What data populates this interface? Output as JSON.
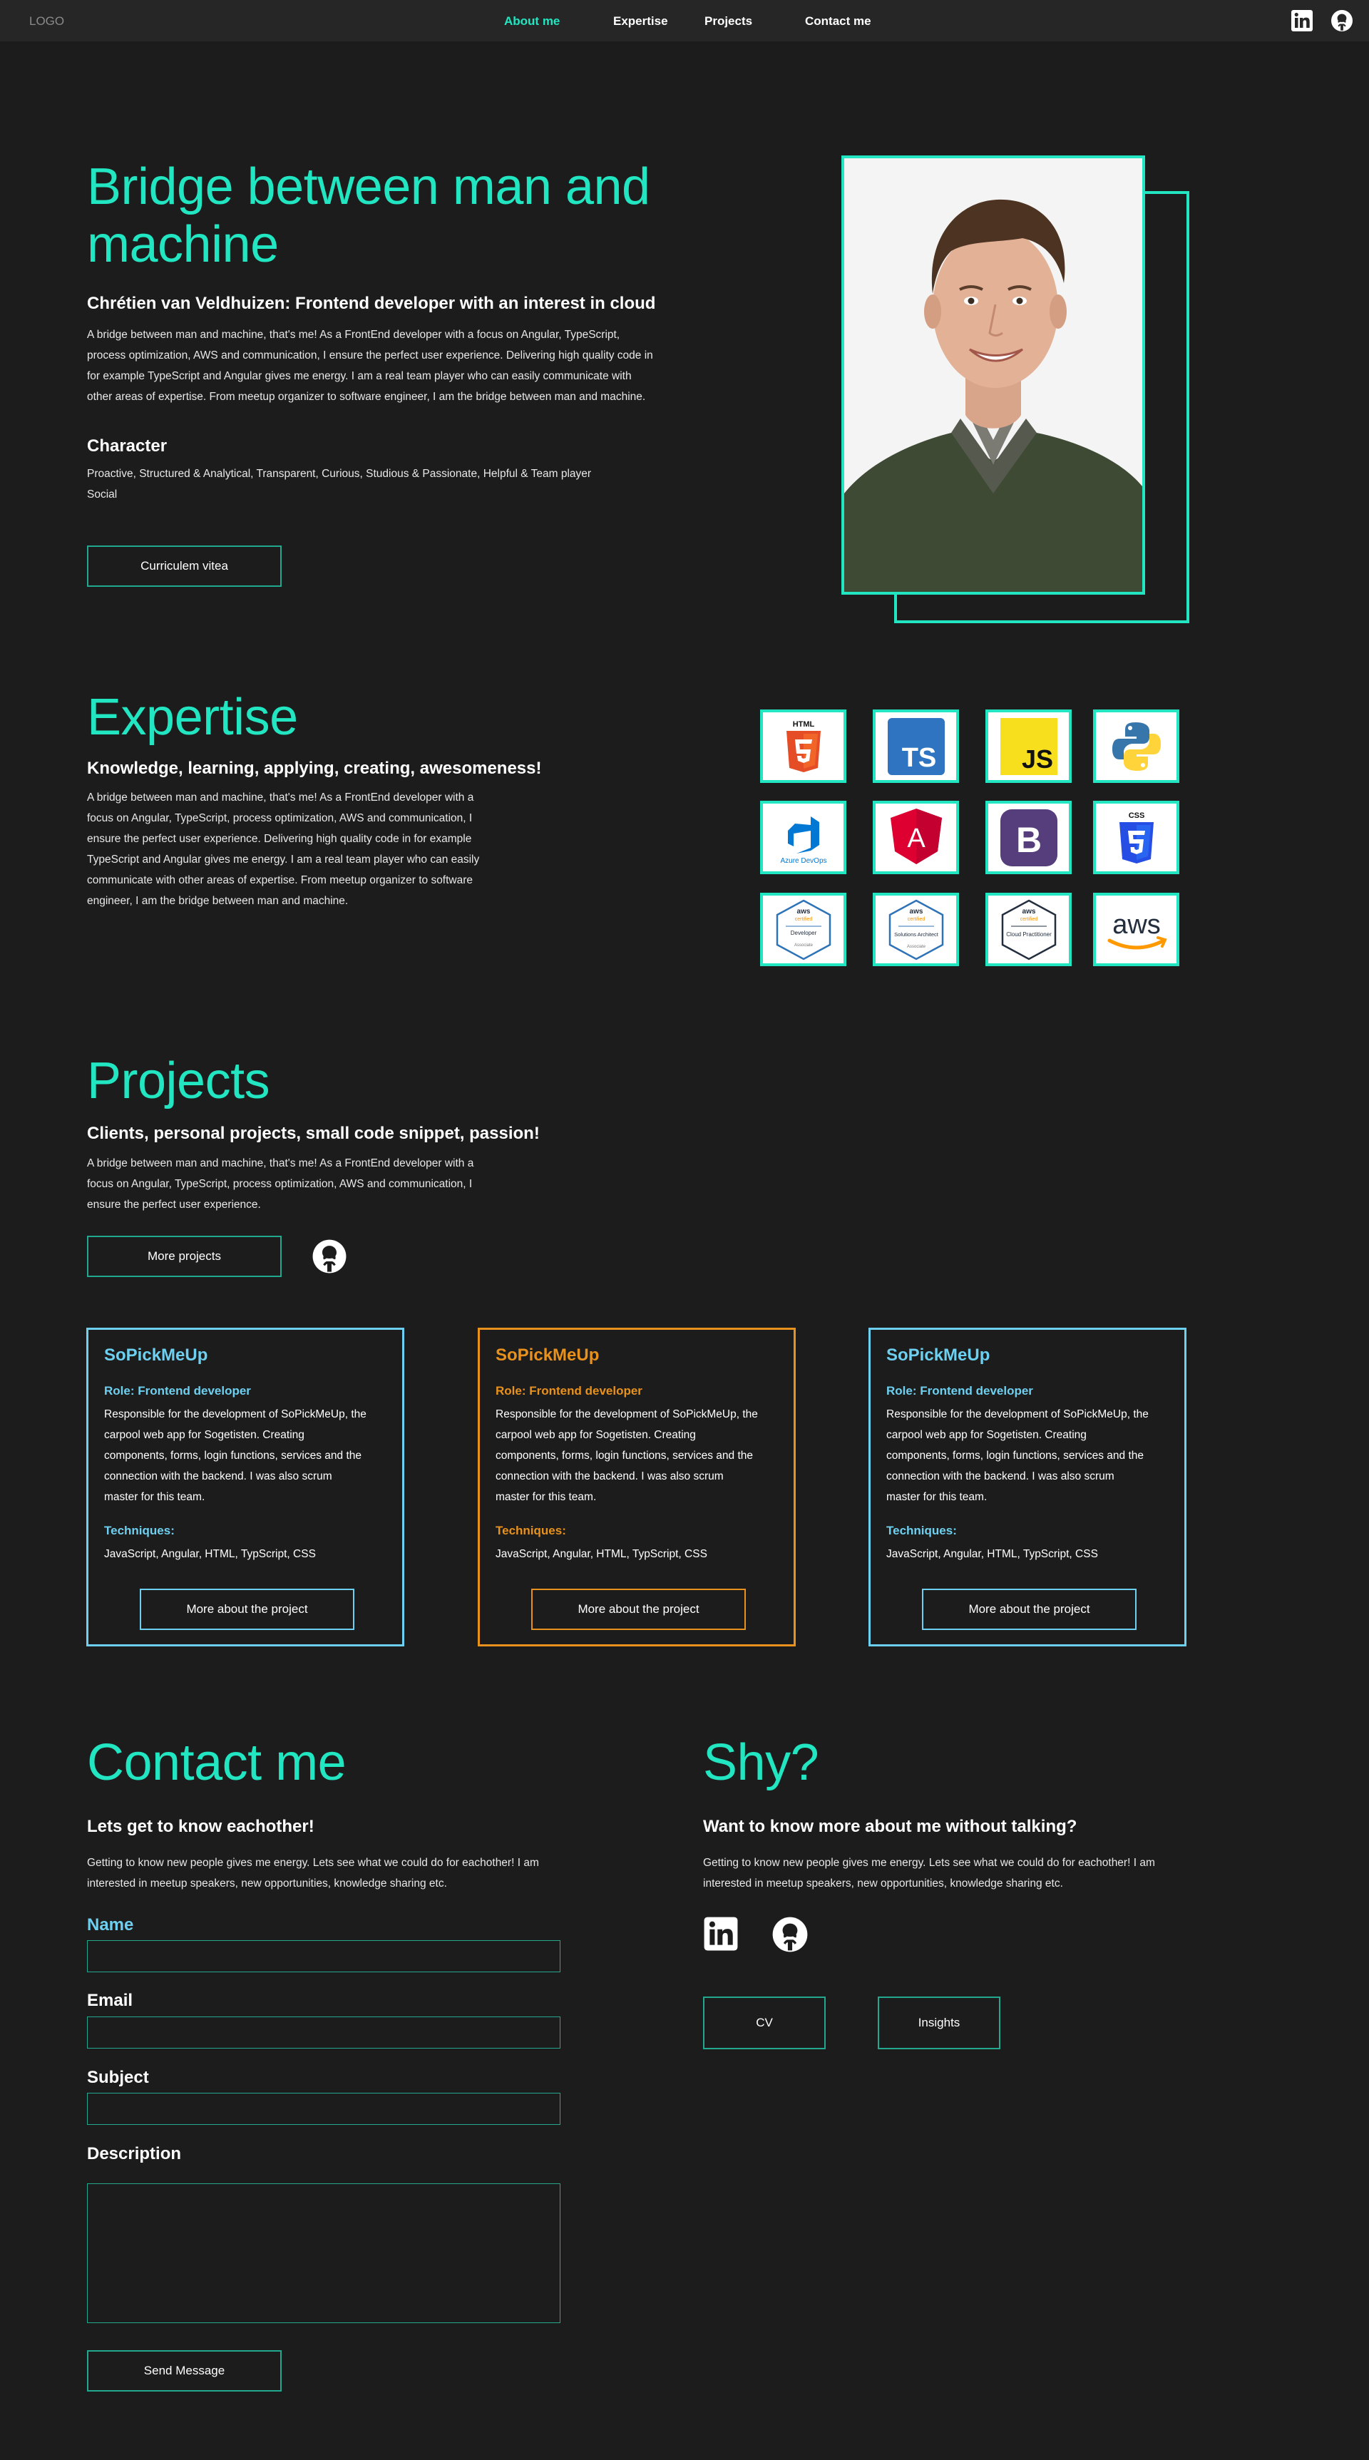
{
  "nav": {
    "logo": "LOGO",
    "links": [
      "About me",
      "Expertise",
      "Projects",
      "Contact me"
    ],
    "icons": [
      "linkedin-icon",
      "github-icon"
    ]
  },
  "colors": {
    "accent": "#21e6c1",
    "blue": "#6ed0f0",
    "orange": "#e8911c",
    "background": "#1c1c1c",
    "navbar": "#262626"
  },
  "hero": {
    "title": "Bridge between man and machine",
    "subtitle": "Chrétien van Veldhuizen: Frontend developer with an interest in cloud",
    "paragraph_lines": [
      "A bridge between man and machine, that's me! As a FrontEnd developer with a focus on Angular, TypeScript,",
      "process optimization, AWS and communication, I ensure the perfect user experience. Delivering high quality code in",
      "for example TypeScript and Angular gives me energy. I am a real team player who can easily communicate with",
      "other areas of expertise. From meetup organizer to software engineer, I am the bridge between man and machine."
    ],
    "character_heading": "Character",
    "character_lines": [
      "Proactive, Structured & Analytical, Transparent, Curious, Studious & Passionate, Helpful & Team player",
      "Social"
    ],
    "cv_button": "Curriculem vitea"
  },
  "expertise": {
    "title": "Expertise",
    "subtitle": "Knowledge, learning, applying, creating, awesomeness!",
    "paragraph_lines": [
      "A bridge between man and machine, that's me! As a FrontEnd developer with a",
      "focus on Angular, TypeScript, process optimization, AWS and communication, I",
      "ensure the perfect user experience. Delivering high quality code in for example",
      "TypeScript and Angular gives me energy. I am a real team player who can easily",
      "communicate with other areas of expertise. From meetup organizer to software",
      "engineer, I am the bridge between man and machine."
    ],
    "tiles": [
      {
        "name": "html5-icon",
        "label": "HTML"
      },
      {
        "name": "typescript-icon",
        "label": "TS"
      },
      {
        "name": "javascript-icon",
        "label": "JS"
      },
      {
        "name": "python-icon",
        "label": ""
      },
      {
        "name": "azure-devops-icon",
        "label": "Azure DevOps"
      },
      {
        "name": "angular-icon",
        "label": "A"
      },
      {
        "name": "bootstrap-icon",
        "label": "B"
      },
      {
        "name": "css3-icon",
        "label": "CSS"
      },
      {
        "name": "aws-developer-badge",
        "label": "Developer"
      },
      {
        "name": "aws-solutions-architect-badge",
        "label": "Solutions Architect"
      },
      {
        "name": "aws-cloud-practitioner-badge",
        "label": "Cloud Practitioner"
      },
      {
        "name": "aws-logo",
        "label": "aws"
      }
    ]
  },
  "projects": {
    "title": "Projects",
    "subtitle": "Clients, personal projects, small code snippet, passion!",
    "paragraph_lines": [
      "A bridge between man and machine, that's me! As a FrontEnd developer with a",
      "focus on Angular, TypeScript, process optimization, AWS and communication, I",
      "ensure the perfect user experience."
    ],
    "more_button": "More projects",
    "cards": [
      {
        "title": "SoPickMeUp",
        "role": "Role: Frontend developer",
        "desc_lines": [
          "Responsible for the development of SoPickMeUp, the",
          "carpool web app for Sogetisten. Creating",
          "components, forms, login functions, services and the",
          "connection with the backend. I was also scrum",
          "master for this team."
        ],
        "techniques_label": "Techniques:",
        "techniques": "JavaScript, Angular, HTML, TypScript, CSS",
        "button": "More about the project"
      },
      {
        "title": "SoPickMeUp",
        "role": "Role: Frontend developer",
        "desc_lines": [
          "Responsible for the development of SoPickMeUp, the",
          "carpool web app for Sogetisten. Creating",
          "components, forms, login functions, services and the",
          "connection with the backend. I was also scrum",
          "master for this team."
        ],
        "techniques_label": "Techniques:",
        "techniques": "JavaScript, Angular, HTML, TypScript, CSS",
        "button": "More about the project"
      },
      {
        "title": "SoPickMeUp",
        "role": "Role: Frontend developer",
        "desc_lines": [
          "Responsible for the development of SoPickMeUp, the",
          "carpool web app for Sogetisten. Creating",
          "components, forms, login functions, services and the",
          "connection with the backend. I was also scrum",
          "master for this team."
        ],
        "techniques_label": "Techniques:",
        "techniques": "JavaScript, Angular, HTML, TypScript, CSS",
        "button": "More about the project"
      }
    ]
  },
  "contact": {
    "title": "Contact me",
    "subtitle": "Lets get to know eachother!",
    "paragraph_lines": [
      "Getting to know new people gives me energy. Lets see what we could do for eachother! I am",
      "interested in meetup speakers, new opportunities, knowledge sharing etc."
    ],
    "fields": {
      "name_label": "Name",
      "name_value": "",
      "email_label": "Email",
      "email_value": "",
      "subject_label": "Subject",
      "subject_value": "",
      "description_label": "Description",
      "description_value": ""
    },
    "send_button": "Send Message"
  },
  "shy": {
    "title": "Shy?",
    "subtitle": "Want to know more about me without talking?",
    "paragraph_lines": [
      "Getting to know new people gives me energy. Lets see what we could do for eachother! I am",
      "interested in meetup speakers, new opportunities, knowledge sharing etc."
    ],
    "buttons": [
      "CV",
      "Insights"
    ]
  }
}
